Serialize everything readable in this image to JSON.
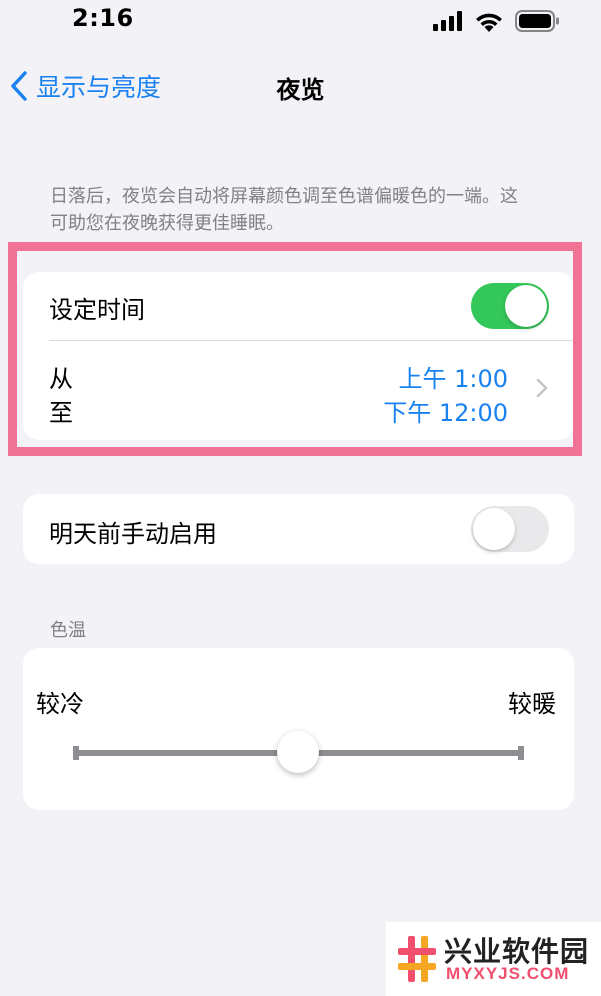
{
  "status_bar": {
    "time": "2:16",
    "icons": [
      "cellular-signal-icon",
      "wifi-icon",
      "battery-icon"
    ]
  },
  "nav": {
    "back_label": "显示与亮度",
    "title": "夜览"
  },
  "intro_text": "日落后，夜览会自动将屏幕颜色调至色谱偏暖色的一端。这可助您在夜晚获得更佳睡眠。",
  "schedule": {
    "label": "设定时间",
    "enabled": true,
    "from_label": "从",
    "to_label": "至",
    "from_value": "上午 1:00",
    "to_value": "下午 12:00"
  },
  "manual": {
    "label": "明天前手动启用",
    "enabled": false
  },
  "color_temp": {
    "section_header": "色温",
    "min_label": "较冷",
    "max_label": "较暖",
    "value": 0.5
  },
  "watermark": {
    "title": "兴业软件园",
    "url": "MYXYJS.COM"
  },
  "colors": {
    "accent": "#1a82f0",
    "toggle_on": "#34c759",
    "highlight": "#f07294",
    "background": "#f2f2f7"
  }
}
